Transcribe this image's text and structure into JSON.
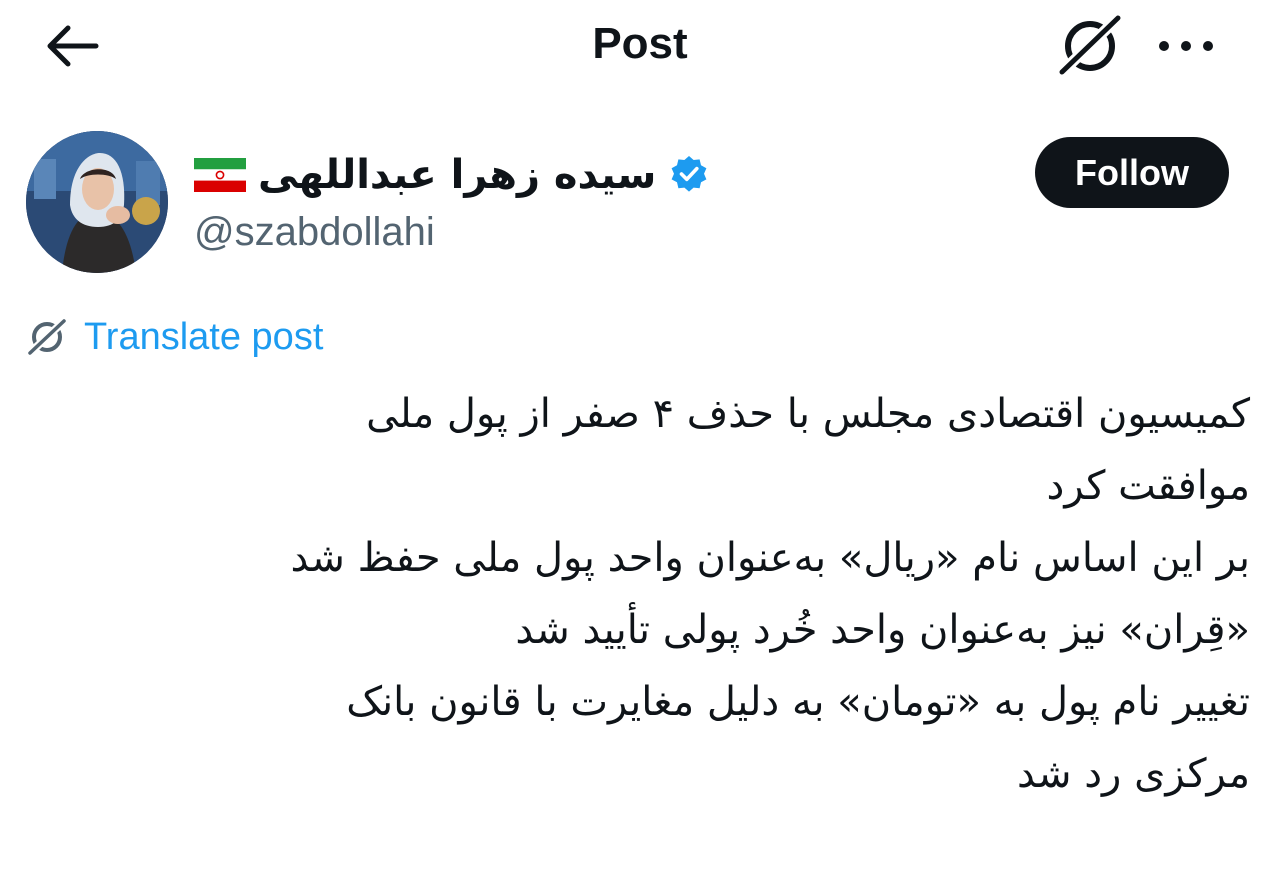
{
  "header": {
    "title": "Post",
    "back_icon": "arrow-left-icon",
    "grok_icon": "grok-icon",
    "more_icon": "more-horizontal-icon"
  },
  "author": {
    "name": "سیده زهرا عبداللهی",
    "handle": "@szabdollahi",
    "verified": true,
    "flag_icon": "iran-flag-icon",
    "verified_color": "#1d9bf0"
  },
  "follow_label": "Follow",
  "translate_label": "Translate post",
  "post_lines": [
    "کمیسیون اقتصادی مجلس با حذف ۴ صفر از پول ملی",
    "موافقت کرد",
    "بر این اساس نام «ریال» به‌عنوان واحد پول ملی حفظ شد",
    "«قِران» نیز به‌عنوان واحد خُرد پولی تأیید شد",
    "تغییر نام پول به «تومان» به دلیل مغایرت با قانون بانک",
    "مرکزی رد شد"
  ],
  "colors": {
    "text": "#0f1419",
    "secondary": "#536471",
    "link": "#1d9bf0",
    "button_bg": "#0f1419",
    "button_text": "#ffffff"
  }
}
